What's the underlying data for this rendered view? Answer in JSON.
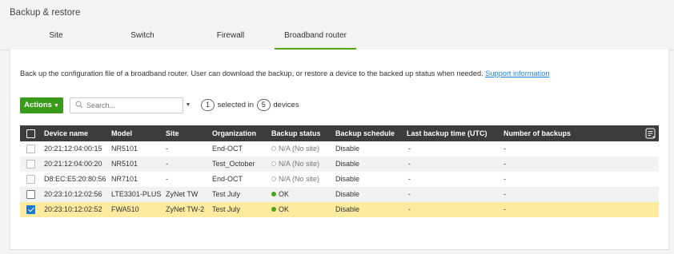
{
  "page": {
    "title": "Backup & restore"
  },
  "tabs": [
    {
      "label": "Site"
    },
    {
      "label": "Switch"
    },
    {
      "label": "Firewall"
    },
    {
      "label": "Broadband router",
      "active": true
    }
  ],
  "description": {
    "text": "Back up the configuration file of a broadband router. User can download the backup, or restore a device to the backed up status when needed.",
    "link": "Support information"
  },
  "toolbar": {
    "actions_label": "Actions",
    "search_placeholder": "Search...",
    "selected_count": "1",
    "selected_text": "selected in",
    "device_count": "5",
    "devices_text": "devices"
  },
  "table": {
    "columns": [
      "Device name",
      "Model",
      "Site",
      "Organization",
      "Backup status",
      "Backup schedule",
      "Last backup time (UTC)",
      "Number of backups"
    ],
    "rows": [
      {
        "device": "20:21:12:04:00:15",
        "model": "NR5101",
        "site": "-",
        "org": "End-OCT",
        "status": "N/A (No site)",
        "schedule": "Disable",
        "last": "-",
        "count": "-"
      },
      {
        "device": "20:21:12:04:00:20",
        "model": "NR5101",
        "site": "-",
        "org": "Test_October",
        "status": "N/A (No site)",
        "schedule": "Disable",
        "last": "-",
        "count": "-"
      },
      {
        "device": "D8:EC:E5:20:80:56",
        "model": "NR7101",
        "site": "-",
        "org": "End-OCT",
        "status": "N/A (No site)",
        "schedule": "Disable",
        "last": "-",
        "count": "-"
      },
      {
        "device": "20:23:10:12:02:56",
        "model": "LTE3301-PLUS",
        "site": "ZyNet TW",
        "org": "Test July",
        "status": "OK",
        "schedule": "Disable",
        "last": "-",
        "count": "-"
      },
      {
        "device": "20:23:10:12:02:52",
        "model": "FWA510",
        "site": "ZyNet TW-2",
        "org": "Test July",
        "status": "OK",
        "schedule": "Disable",
        "last": "-",
        "count": "-"
      }
    ]
  },
  "colors": {
    "accent": "#52a51b",
    "header_bg": "#3c3c3c",
    "selected_row": "#fdeba0",
    "ok": "#46a620",
    "link": "#1e88e5"
  },
  "icons": {
    "search": "search-icon",
    "column_settings": "column-settings-icon"
  }
}
